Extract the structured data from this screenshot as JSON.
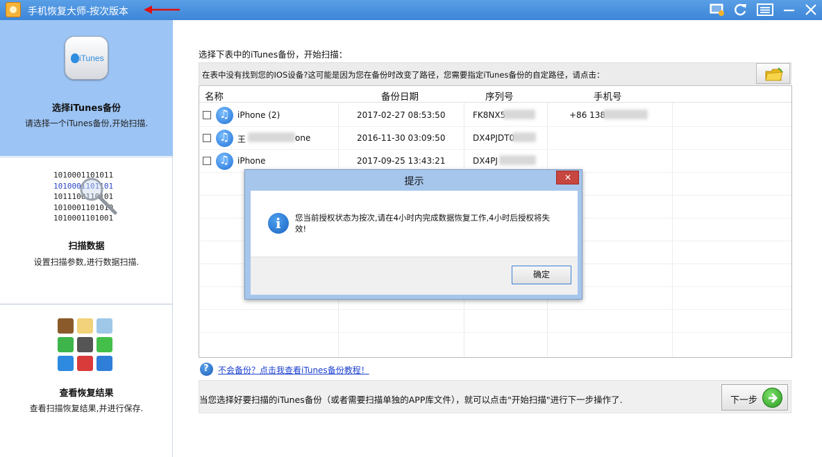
{
  "window": {
    "title": "手机恢复大师-按次版本",
    "controls": [
      "screen-icon",
      "refresh-icon",
      "menu-icon",
      "minimize-icon",
      "close-icon"
    ]
  },
  "sidebar": {
    "steps": [
      {
        "title": "选择iTunes备份",
        "desc": "请选择一个iTunes备份,开始扫描.",
        "icon": "itunes-icon",
        "active": true
      },
      {
        "title": "扫描数据",
        "desc": "设置扫描参数,进行数据扫描.",
        "icon": "binary-scan-icon",
        "active": false
      },
      {
        "title": "查看恢复结果",
        "desc": "查看扫描恢复结果,并进行保存.",
        "icon": "data-types-icon",
        "active": false
      }
    ],
    "itunes_label": "iTunes",
    "binary_lines": [
      "1010001101011",
      "1010001101101",
      "1011100110101",
      "1010001101010",
      "1010001101001"
    ]
  },
  "main": {
    "instruction": "选择下表中的iTunes备份，开始扫描：",
    "path_hint": "在表中没有找到您的IOS设备?这可能是因为您在备份时改变了路径，您需要指定iTunes备份的自定路径，请点击：",
    "table": {
      "headers": [
        "名称",
        "备份日期",
        "序列号",
        "手机号"
      ],
      "rows": [
        {
          "name": "iPhone (2)",
          "date": "2017-02-27 08:53:50",
          "serial": "FK8NX5",
          "phone": "+86 138"
        },
        {
          "name_prefix": "王",
          "name_suffix": "one",
          "date": "2016-11-30 03:09:50",
          "serial": "DX4PJDT0",
          "phone": ""
        },
        {
          "name": "iPhone",
          "date": "2017-09-25 13:43:21",
          "serial": "DX4PJ",
          "phone": ""
        }
      ]
    },
    "help_link": "不会备份？点击我查看iTunes备份教程！",
    "bottom_text": "当您选择好要扫描的iTunes备份（或者需要扫描单独的APP库文件），就可以点击\"开始扫描\"进行下一步操作了.",
    "next_button": "下一步"
  },
  "dialog": {
    "title": "提示",
    "message": "您当前授权状态为按次,请在4小时内完成数据恢复工作,4小时后授权将失效!",
    "ok_label": "确定"
  },
  "colors": {
    "titlebar": "#4a93e0",
    "active_step": "#9cc4f4",
    "dialog_frame": "#a6c6ec",
    "link": "#1a3fcf"
  }
}
